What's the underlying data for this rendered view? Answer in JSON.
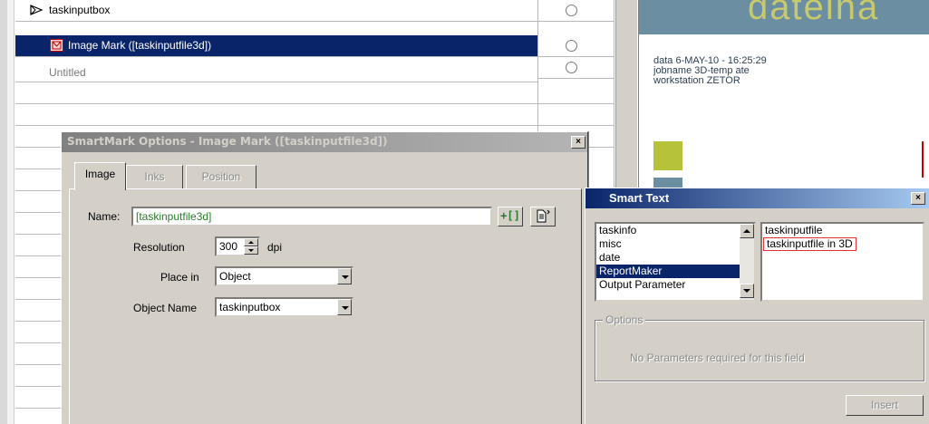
{
  "tree": {
    "rows": [
      {
        "label": "taskinputbox"
      },
      {
        "label": "Image Mark ([taskinputfile3d])"
      },
      {
        "label": "Untitled"
      }
    ]
  },
  "preview": {
    "banner_text": "dateina",
    "info_lines": [
      "data 6-MAY-10 - 16:25:29",
      "jobname 3D-temp ate",
      "workstation ZETOR"
    ],
    "colors": {
      "banner": "#6b8ea3",
      "square": "#b6c23a"
    }
  },
  "smartmark": {
    "title": "SmartMark Options - Image Mark ([taskinputfile3d])",
    "close_label": "×",
    "tabs": [
      {
        "label": "Image",
        "active": true
      },
      {
        "label": "Inks",
        "active": false
      },
      {
        "label": "Position",
        "active": false
      }
    ],
    "name_label": "Name:",
    "name_value": "[taskinputfile3d]",
    "insert_smart_icon": "+[]",
    "doc_icon": "doc-icon",
    "resolution_label": "Resolution",
    "resolution_value": "300",
    "resolution_unit": "dpi",
    "place_in_label": "Place in",
    "place_in_value": "Object",
    "object_name_label": "Object Name",
    "object_name_value": "taskinputbox"
  },
  "smarttext": {
    "title": "Smart Text",
    "close_label": "×",
    "categories": [
      "taskinfo",
      "misc",
      "date",
      "ReportMaker",
      "Output Parameter"
    ],
    "selected_category": 3,
    "fields": [
      "taskinputfile",
      "taskinputfile in 3D"
    ],
    "highlighted_field": 1,
    "options_label": "Options",
    "options_text": "No Parameters required for this field",
    "insert_label": "Insert"
  }
}
